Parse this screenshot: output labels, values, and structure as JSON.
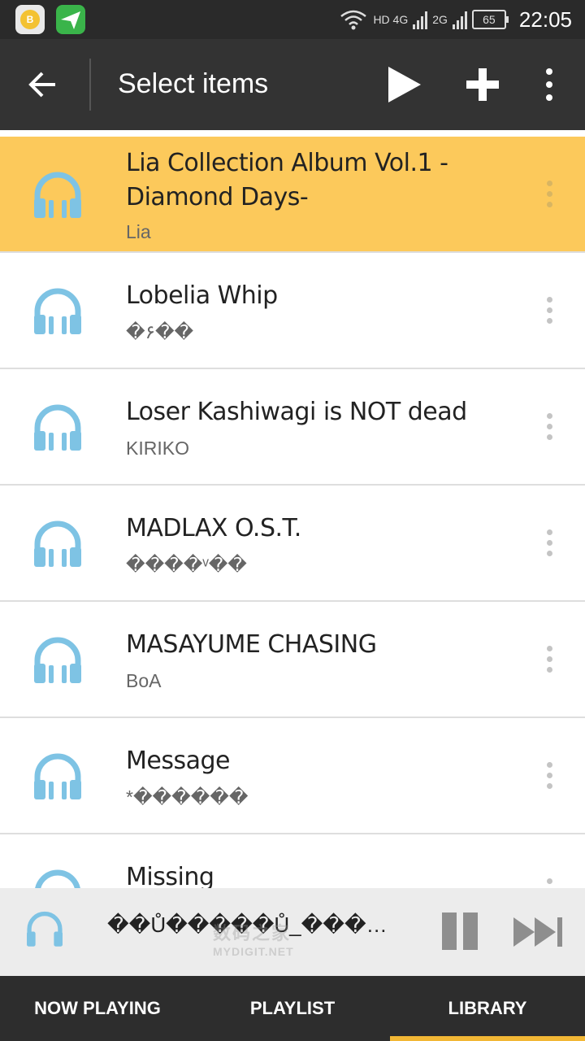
{
  "status_bar": {
    "app1_label": "B",
    "network_text": "HD 4G",
    "network2_text": "2G",
    "battery": "65",
    "time": "22:05"
  },
  "toolbar": {
    "title": "Select items"
  },
  "albums": [
    {
      "title": "Lia Collection Album Vol.1 - Diamond Days-",
      "artist": "Lia",
      "selected": true
    },
    {
      "title": "Lobelia Whip",
      "artist": "�۶��",
      "selected": false
    },
    {
      "title": "Loser Kashiwagi is NOT dead",
      "artist": "KIRIKO",
      "selected": false
    },
    {
      "title": "MADLAX O.S.T.",
      "artist": "����ᵛ��",
      "selected": false
    },
    {
      "title": "MASAYUME CHASING",
      "artist": "BoA",
      "selected": false
    },
    {
      "title": "Message",
      "artist": "*������",
      "selected": false
    },
    {
      "title": "Missing",
      "artist": "",
      "selected": false
    }
  ],
  "now_playing": {
    "text": "��Ů�����Ů_���…",
    "watermark": "数码之家",
    "watermark_url": "MYDIGIT.NET"
  },
  "tabs": {
    "now_playing": "NOW PLAYING",
    "playlist": "PLAYLIST",
    "library": "LIBRARY"
  },
  "colors": {
    "selected_row": "#fcc95b",
    "headphone_icon": "#7ec3e4",
    "active_tab_indicator": "#f2b735",
    "toolbar": "#333333"
  }
}
